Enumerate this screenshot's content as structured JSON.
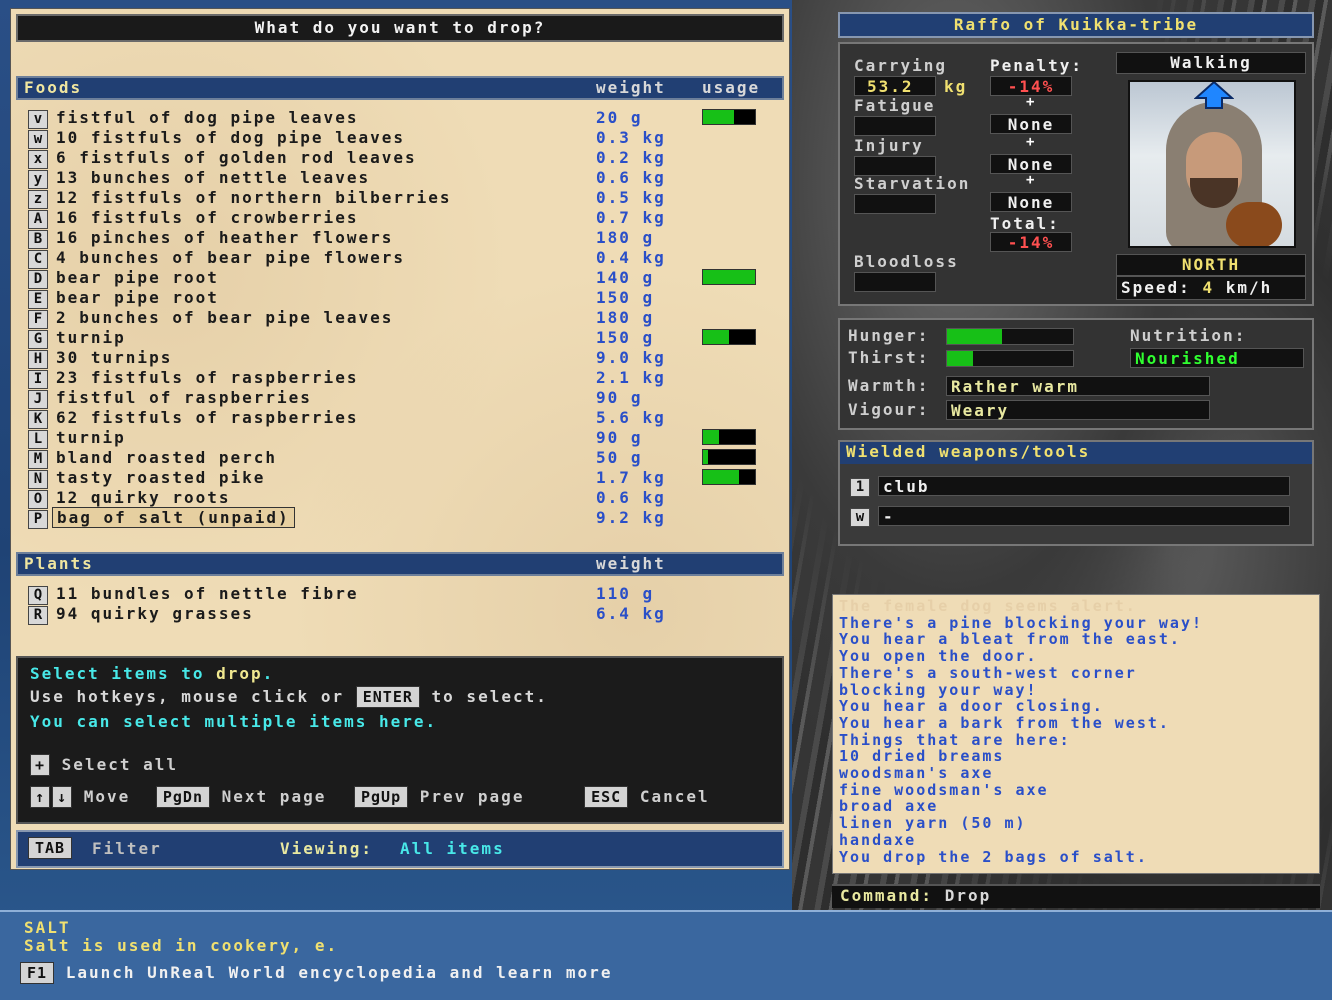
{
  "title": "What do you want to drop?",
  "foods": {
    "header": "Foods",
    "col_weight": "weight",
    "col_usage": "usage",
    "items": [
      {
        "key": "v",
        "name": "fistful of dog pipe leaves",
        "weight": "20 g",
        "usage": 0.6
      },
      {
        "key": "w",
        "name": "10 fistfuls of dog pipe leaves",
        "weight": "0.3 kg"
      },
      {
        "key": "x",
        "name": "6 fistfuls of golden rod leaves",
        "weight": "0.2 kg"
      },
      {
        "key": "y",
        "name": "13 bunches of nettle leaves",
        "weight": "0.6 kg"
      },
      {
        "key": "z",
        "name": "12 fistfuls of northern bilberries",
        "weight": "0.5 kg"
      },
      {
        "key": "A",
        "name": "16 fistfuls of crowberries",
        "weight": "0.7 kg"
      },
      {
        "key": "B",
        "name": "16 pinches of heather flowers",
        "weight": "180 g"
      },
      {
        "key": "C",
        "name": "4 bunches of bear pipe flowers",
        "weight": "0.4 kg"
      },
      {
        "key": "D",
        "name": "bear pipe root",
        "weight": "140 g",
        "usage": 1.0
      },
      {
        "key": "E",
        "name": "bear pipe root",
        "weight": "150 g"
      },
      {
        "key": "F",
        "name": "2 bunches of bear pipe leaves",
        "weight": "180 g"
      },
      {
        "key": "G",
        "name": "turnip",
        "weight": "150 g",
        "usage": 0.5
      },
      {
        "key": "H",
        "name": "30 turnips",
        "weight": "9.0 kg"
      },
      {
        "key": "I",
        "name": "23 fistfuls of raspberries",
        "weight": "2.1 kg"
      },
      {
        "key": "J",
        "name": "fistful of raspberries",
        "weight": "90 g"
      },
      {
        "key": "K",
        "name": "62 fistfuls of raspberries",
        "weight": "5.6 kg"
      },
      {
        "key": "L",
        "name": "turnip",
        "weight": "90 g",
        "usage": 0.3
      },
      {
        "key": "M",
        "name": "bland roasted perch",
        "weight": "50 g",
        "usage": 0.1
      },
      {
        "key": "N",
        "name": "tasty roasted pike",
        "weight": "1.7 kg",
        "usage": 0.7
      },
      {
        "key": "O",
        "name": "12 quirky roots",
        "weight": "0.6 kg"
      },
      {
        "key": "P",
        "name": "bag of salt (unpaid)",
        "weight": "9.2 kg",
        "selected": true
      }
    ]
  },
  "plants": {
    "header": "Plants",
    "col_weight": "weight",
    "items": [
      {
        "key": "Q",
        "name": "11 bundles of nettle fibre",
        "weight": "110 g"
      },
      {
        "key": "R",
        "name": "94 quirky grasses",
        "weight": "6.4 kg"
      }
    ]
  },
  "instructions": {
    "line1_a": "Select items to ",
    "line1_b": "drop",
    "line1_c": ".",
    "line2_a": "Use hotkeys, mouse click or",
    "enter": "ENTER",
    "line2_b": "to select.",
    "line3": "You can select multiple items here.",
    "plus": "+",
    "select_all": "Select all",
    "up": "↑",
    "down": "↓",
    "move": "Move",
    "pgdn": "PgDn",
    "next": "Next page",
    "pgup": "PgUp",
    "prev": "Prev page",
    "esc": "ESC",
    "cancel": "Cancel"
  },
  "filter": {
    "tab": "TAB",
    "label": "Filter",
    "viewing_label": "Viewing:",
    "viewing_value": "All items"
  },
  "character": {
    "name": "Raffo of Kuikka-tribe",
    "carrying_label": "Carrying",
    "carrying_value": "53.2",
    "carrying_unit": "kg",
    "penalty_label": "Penalty:",
    "penalty_value": "-14%",
    "fatigue_label": "Fatigue",
    "injury_label": "Injury",
    "starvation_label": "Starvation",
    "bloodloss_label": "Bloodloss",
    "plus": "+",
    "none": "None",
    "total_label": "Total:",
    "total_value": "-14%",
    "mode": "Walking",
    "direction": "NORTH",
    "speed_label": "Speed:",
    "speed_value": "4",
    "speed_unit": "km/h"
  },
  "status": {
    "hunger_label": "Hunger:",
    "hunger_level": 0.44,
    "thirst_label": "Thirst:",
    "thirst_level": 0.21,
    "nutrition_label": "Nutrition:",
    "nutrition_value": "Nourished",
    "warmth_label": "Warmth:",
    "warmth_value": "Rather warm",
    "vigour_label": "Vigour:",
    "vigour_value": "Weary"
  },
  "weapons": {
    "header": "Wielded weapons/tools",
    "slots": [
      {
        "key": "1",
        "name": "club"
      },
      {
        "key": "w",
        "name": "-"
      }
    ]
  },
  "log": {
    "faded": "The female dog seems alert.",
    "lines": [
      "There's a pine blocking your way!",
      "You hear a bleat from the east.",
      "You open the door.",
      "There's a south-west corner",
      "blocking your way!",
      "You hear a door closing.",
      "You hear a bark from the west.",
      "Things that are here:",
      "10 dried breams",
      "woodsman's axe",
      "fine woodsman's axe",
      "broad axe",
      "linen yarn (50 m)",
      "handaxe",
      "You drop the 2 bags of salt."
    ]
  },
  "command": {
    "label": "Command:",
    "value": "Drop"
  },
  "info": {
    "title": "SALT",
    "desc": "Salt is used in cookery, e.",
    "f1": "F1",
    "encyclopedia": "Launch UnReal World encyclopedia and learn more"
  },
  "colors": {
    "accent_blue": "#2a4fc8",
    "bar_green": "#17c017",
    "penalty_red": "#ff5050",
    "nutrition_green": "#30ff30"
  }
}
